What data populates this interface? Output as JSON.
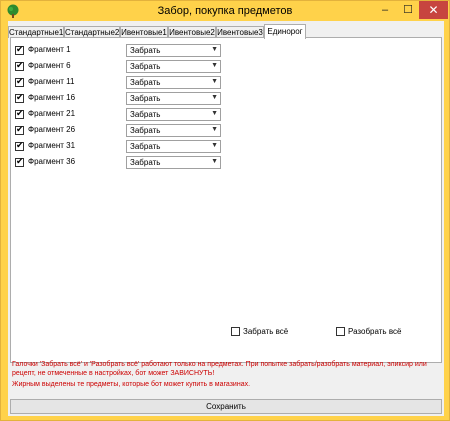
{
  "window": {
    "title": "Забор, покупка предметов"
  },
  "controls": {
    "minimize": "–",
    "maximize": "☐",
    "close": "✕"
  },
  "tabs": [
    {
      "label": "Стандартные1"
    },
    {
      "label": "Стандартные2"
    },
    {
      "label": "Ивентовые1"
    },
    {
      "label": "Ивентовые2"
    },
    {
      "label": "Ивентовые3"
    },
    {
      "label": "Единорог",
      "active": true
    }
  ],
  "items": [
    {
      "label": "Фрагмент 1",
      "checked": true,
      "action": "Забрать"
    },
    {
      "label": "Фрагмент 6",
      "checked": true,
      "action": "Забрать"
    },
    {
      "label": "Фрагмент 11",
      "checked": true,
      "action": "Забрать"
    },
    {
      "label": "Фрагмент 16",
      "checked": true,
      "action": "Забрать"
    },
    {
      "label": "Фрагмент 21",
      "checked": true,
      "action": "Забрать"
    },
    {
      "label": "Фрагмент 26",
      "checked": true,
      "action": "Забрать"
    },
    {
      "label": "Фрагмент 31",
      "checked": true,
      "action": "Забрать"
    },
    {
      "label": "Фрагмент 36",
      "checked": true,
      "action": "Забрать"
    }
  ],
  "footer": {
    "take_all": "Забрать всё",
    "disassemble_all": "Разобрать всё"
  },
  "warning": "Галочки 'Забрать всё' и 'Разобрать всё' работают только на предметах. При попытке забрать/разобрать материал, эликсир или рецепт, не отмеченные в настройках, бот может ЗАВИСНУТЬ!",
  "note": "Жирным выделены те предметы, которые бот может купить в магазинах.",
  "save_label": "Сохранить",
  "icons": {
    "app": "tree-icon",
    "dropdown": "chevron-down-icon"
  },
  "colors": {
    "frame": "#ffd24a",
    "close": "#c7453f",
    "warning_text": "#cc0000"
  }
}
